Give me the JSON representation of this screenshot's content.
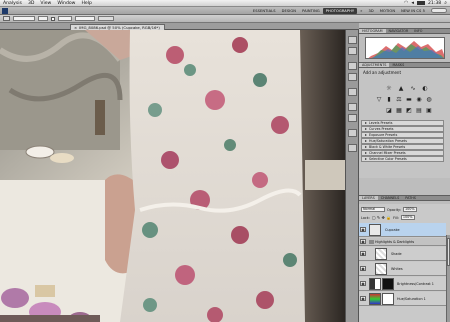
{
  "menubar": {
    "items": [
      "Analysis",
      "3D",
      "View",
      "Window",
      "Help"
    ],
    "time": "21:38"
  },
  "appbar": {
    "workspaces": [
      "ESSENTIALS",
      "DESIGN",
      "PAINTING",
      "PHOTOGRAPHY",
      "3D",
      "MOTION",
      "NEW IN CS 5"
    ],
    "active_workspace": "PHOTOGRAPHY"
  },
  "optionsbar": {
    "mode": "Normal",
    "refine_label": "Refine Edge"
  },
  "document": {
    "tab_title": "IMG_8086.psd @ 50% (Cupcake, RGB/16*)"
  },
  "panels": {
    "top_tabs": [
      "HISTOGRAM",
      "NAVIGATOR",
      "INFO"
    ],
    "adjust_tabs": [
      "ADJUSTMENTS",
      "MASKS"
    ],
    "adjust_header": "Add an adjustment",
    "adjust_icons": [
      "sun-icon",
      "levels-icon",
      "curves-icon",
      "exposure-icon",
      "vibrance-icon",
      "hue-sat-icon",
      "color-balance-icon",
      "bw-icon",
      "photo-filter-icon",
      "channel-mixer-icon",
      "invert-icon",
      "posterize-icon",
      "threshold-icon",
      "gradient-map-icon",
      "selective-color-icon"
    ],
    "presets": [
      "Levels Presets",
      "Curves Presets",
      "Exposure Presets",
      "Hue/Saturation Presets",
      "Black & White Presets",
      "Channel Mixer Presets",
      "Selective Color Presets"
    ],
    "layers_tabs": [
      "LAYERS",
      "CHANNELS",
      "PATHS"
    ],
    "blend_mode": "Normal",
    "opacity_label": "Opacity:",
    "opacity": "100%",
    "lock_label": "Lock:",
    "fill_label": "Fill:",
    "fill": "100%",
    "layers": [
      {
        "name": "Cupcake",
        "type": "layer",
        "selected": true
      },
      {
        "name": "Highlights & Darklights",
        "type": "group",
        "selected": false
      },
      {
        "name": "Shade",
        "type": "layer",
        "selected": false
      },
      {
        "name": "Whites",
        "type": "layer",
        "selected": false
      },
      {
        "name": "Brightness/Contrast 1",
        "type": "adjustment",
        "selected": false
      },
      {
        "name": "Hue/Saturation 1",
        "type": "adjustment",
        "selected": false
      }
    ]
  },
  "colors": {
    "panel_bg": "#bdbdbd",
    "selected_layer": "#b9d3ee",
    "active_workspace_bg": "#3b3b3b"
  }
}
